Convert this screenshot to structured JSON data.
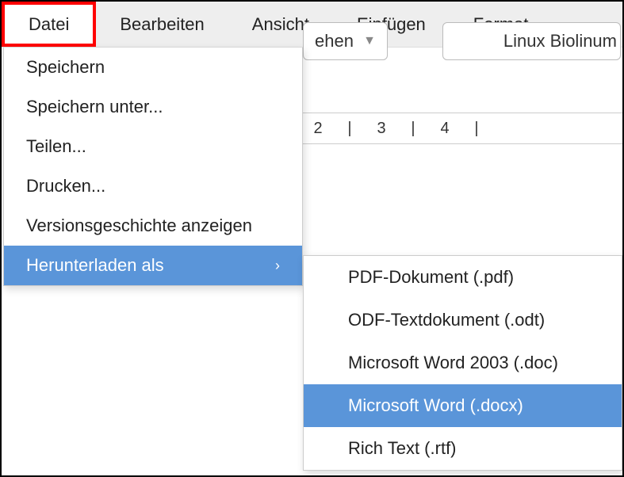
{
  "menubar": {
    "items": [
      "Datei",
      "Bearbeiten",
      "Ansicht",
      "Einfügen",
      "Format"
    ]
  },
  "toolbar": {
    "style_dropdown_visible_text": "ehen",
    "font_name": "Linux Biolinum"
  },
  "ruler": {
    "marks": [
      "2",
      "|",
      "3",
      "|",
      "4",
      "|"
    ]
  },
  "file_menu": {
    "items": [
      "Speichern",
      "Speichern unter...",
      "Teilen...",
      "Drucken...",
      "Versionsgeschichte anzeigen",
      "Herunterladen als"
    ]
  },
  "download_submenu": {
    "items": [
      "PDF-Dokument (.pdf)",
      "ODF-Textdokument (.odt)",
      "Microsoft Word 2003 (.doc)",
      "Microsoft Word (.docx)",
      "Rich Text (.rtf)"
    ]
  }
}
